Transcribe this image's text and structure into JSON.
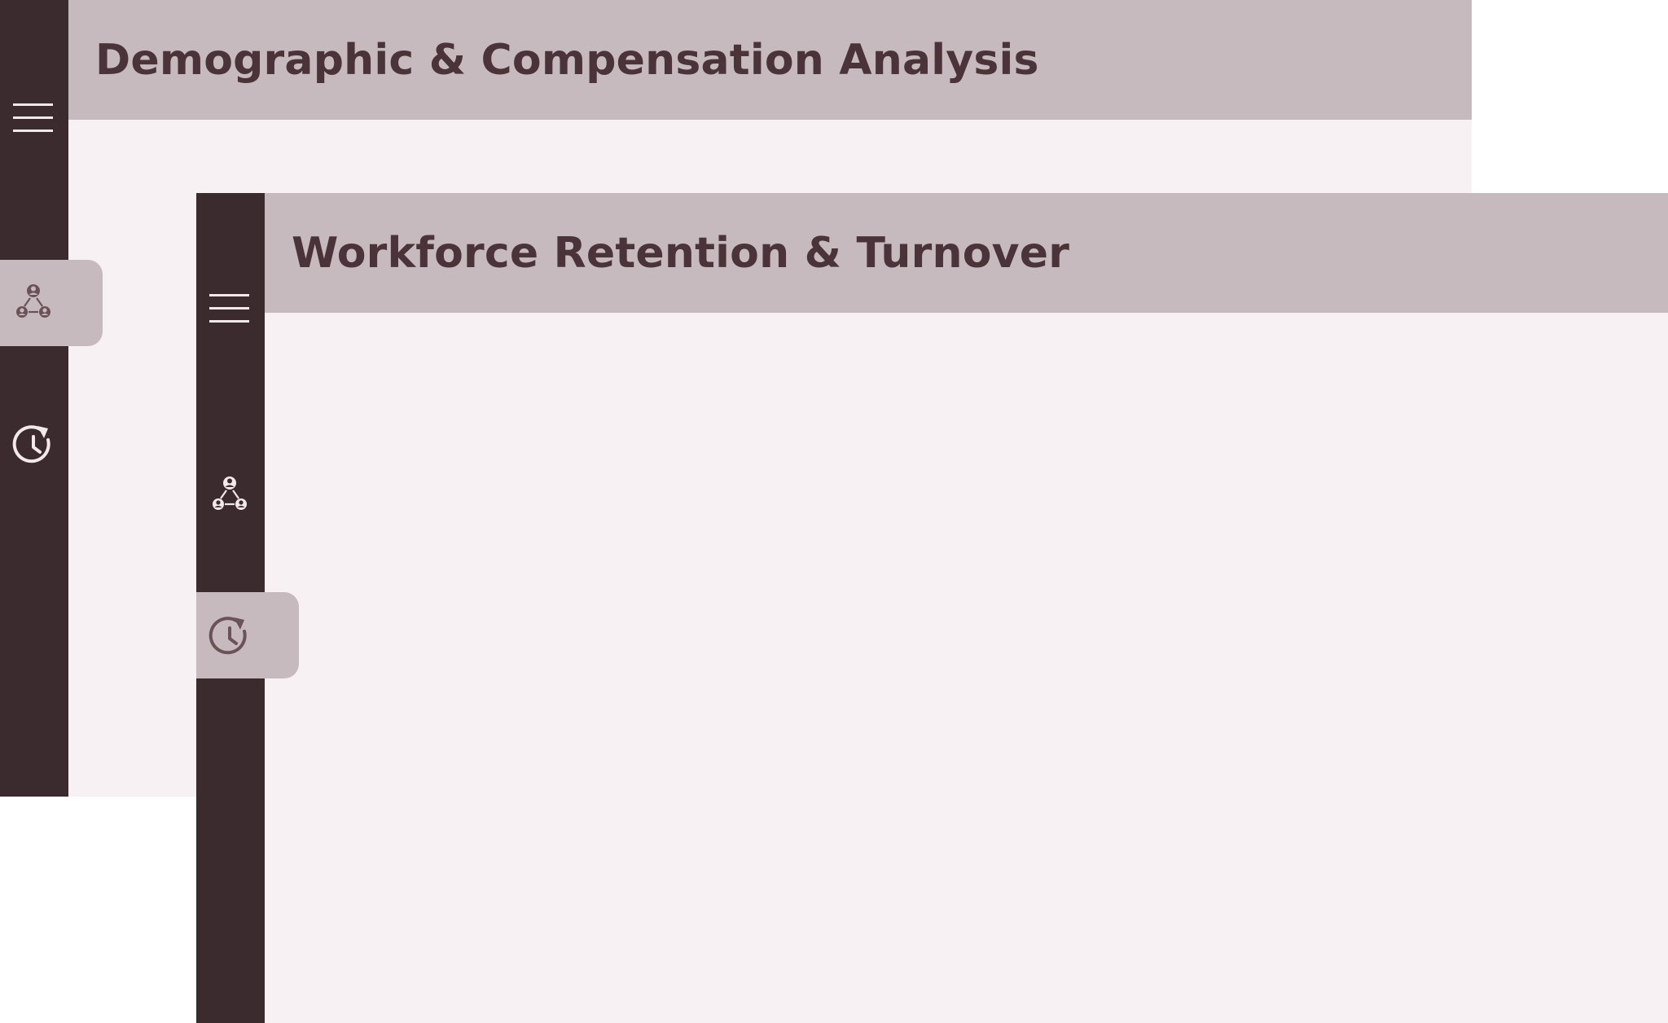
{
  "windows": [
    {
      "title": "Demographic & Compensation Analysis",
      "nav": {
        "menu_icon": "hamburger-menu-icon",
        "items": [
          {
            "icon": "org-hierarchy-icon",
            "active": true
          },
          {
            "icon": "history-clock-icon",
            "active": false
          }
        ]
      }
    },
    {
      "title": "Workforce Retention & Turnover",
      "nav": {
        "menu_icon": "hamburger-menu-icon",
        "items": [
          {
            "icon": "org-hierarchy-icon",
            "active": false
          },
          {
            "icon": "history-clock-icon",
            "active": true
          }
        ]
      }
    }
  ],
  "colors": {
    "rail": "#3b2b2f",
    "header": "#c6babe",
    "canvas": "#f7f1f3",
    "title_text": "#4a343a",
    "rail_icon": "#f3e9ec",
    "active_icon": "#6a5258"
  }
}
